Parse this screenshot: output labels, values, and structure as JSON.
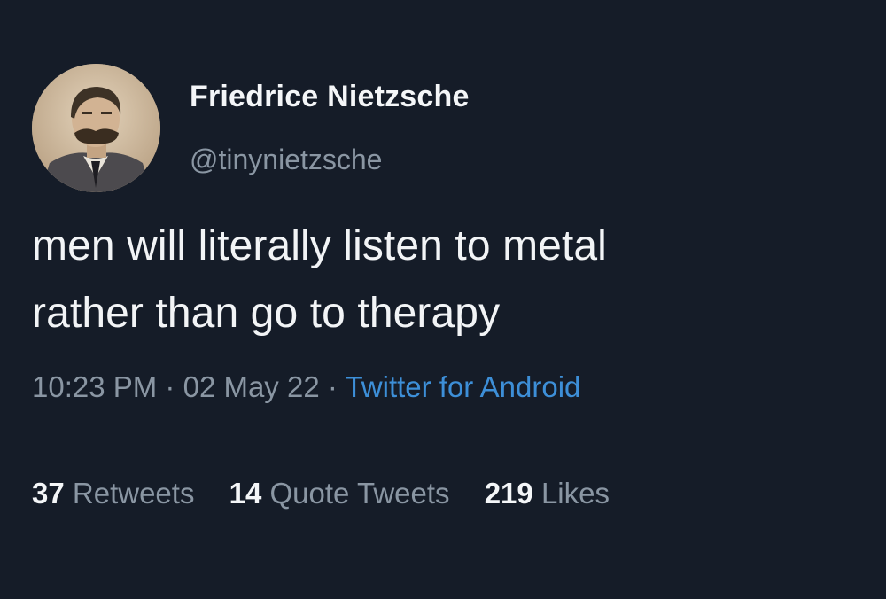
{
  "tweet": {
    "author": {
      "display_name": "Friedrice Nietzsche",
      "handle": "@tinynietzsche",
      "avatar_icon": "portrait-avatar"
    },
    "text_lines": [
      "men will literally listen to metal",
      "rather than go to therapy"
    ],
    "meta": {
      "time": "10:23 PM",
      "separator": "·",
      "date": "02 May 22",
      "source": "Twitter for Android"
    },
    "stats": {
      "retweets_count": "37",
      "retweets_label": "Retweets",
      "quotes_count": "14",
      "quotes_label": "Quote Tweets",
      "likes_count": "219",
      "likes_label": "Likes"
    }
  },
  "colors": {
    "background": "#151c28",
    "text_primary": "#f2f4f6",
    "text_secondary": "#8a96a3",
    "link": "#3d8fd8"
  }
}
